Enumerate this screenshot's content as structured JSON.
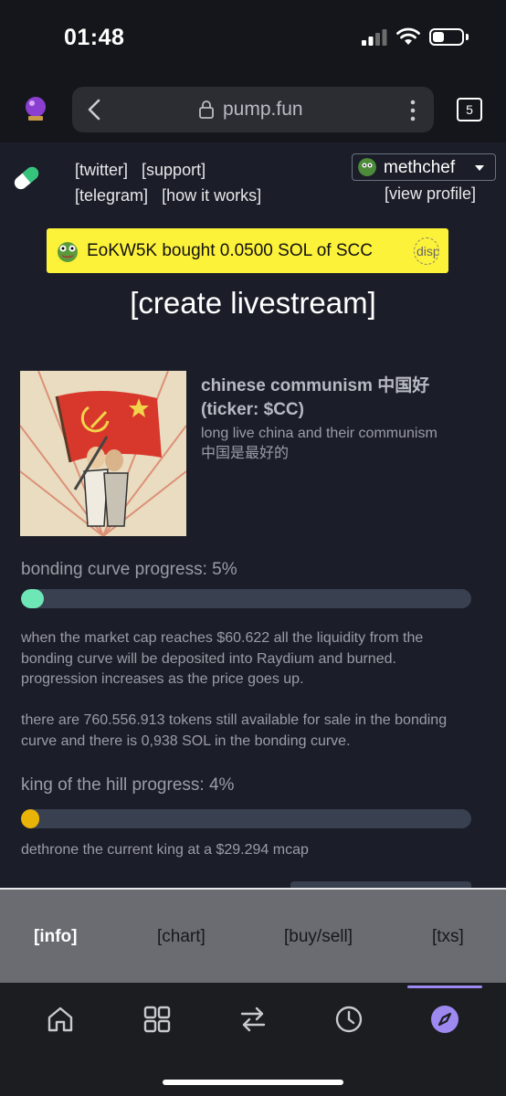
{
  "status_bar": {
    "time": "01:48"
  },
  "browser": {
    "url": "pump.fun",
    "tab_count": "5"
  },
  "header": {
    "links": [
      "[twitter]",
      "[support]",
      "[telegram]",
      "[how it works]"
    ],
    "username": "methchef",
    "view_profile": "[view profile]"
  },
  "ticker": {
    "text": "EoKW5K  bought 0.0500 SOL of SCC",
    "image_text": "disp"
  },
  "create_livestream": "[create livestream]",
  "token": {
    "name": "chinese communism 中国好",
    "ticker": "(ticker: $CC)",
    "description_line1": "long live china and their communism",
    "description_line2": "中国是最好的"
  },
  "bonding_curve": {
    "label": "bonding curve progress: 5%",
    "progress": 0.05,
    "color": "#6ee7b7",
    "info1": "when the market cap reaches $60.622 all the liquidity from the bonding curve will be deposited into Raydium and burned. progression increases as the price goes up.",
    "info2": "there are 760.556.913 tokens still available for sale in the bonding curve and there is 0,938 SOL in the bonding curve."
  },
  "king_of_hill": {
    "label": "king of the hill progress: 4%",
    "progress": 0.04,
    "color": "#eab308",
    "info": "dethrone the current king at a $29.294 mcap"
  },
  "tabs": {
    "info": "[info]",
    "chart": "[chart]",
    "buy_sell": "[buy/sell]",
    "txs": "[txs]",
    "active": "info"
  },
  "nav": {
    "icons": [
      "home-icon",
      "grid-icon",
      "swap-icon",
      "history-icon",
      "compass-icon"
    ],
    "active": "compass-icon",
    "accent": "#9d89f0"
  }
}
